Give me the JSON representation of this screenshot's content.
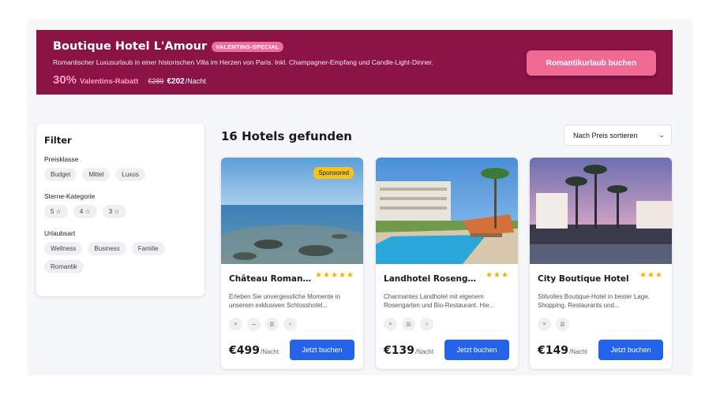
{
  "promo": {
    "title": "Boutique Hotel L'Amour",
    "badge": "VALENTINS-SPECIAL",
    "description": "Romantischer Luxusurlaub in einer historischen Villa im Herzen von Paris. Inkl. Champagner-Empfang und Candle-Light-Dinner.",
    "discount_pct": "30%",
    "discount_label": "Valentins-Rabatt",
    "old_price": "€289",
    "new_price": "€202",
    "unit": "/Nacht",
    "cta": "Romantikurlaub buchen"
  },
  "filter": {
    "title": "Filter",
    "groups": [
      {
        "title": "Preisklasse",
        "chips": [
          "Budget",
          "Mittel",
          "Luxus"
        ]
      },
      {
        "title": "Sterne-Kategorie",
        "chips": [
          "5 ☆",
          "4 ☆",
          "3 ☆"
        ]
      },
      {
        "title": "Urlaubsart",
        "chips": [
          "Wellness",
          "Business",
          "Familie",
          "Romantik"
        ]
      }
    ]
  },
  "results": {
    "title": "16 Hotels gefunden",
    "sort_label": "Nach Preis sortieren"
  },
  "hotels": [
    {
      "name": "Château Roman...",
      "stars": "★★★★★",
      "sponsored": "Sponsored",
      "description": "Erleben Sie unvergessliche Momente in unserem exklusiven Schlosshotel...",
      "amenities": [
        "wifi-icon",
        "pool-icon",
        "restaurant-icon",
        "spa-icon"
      ],
      "price": "€499",
      "unit": "/Nacht",
      "cta": "Jetzt buchen"
    },
    {
      "name": "Landhotel Rosengar...",
      "stars": "★★★",
      "description": "Charmantes Landhotel mit eigenem Rosengarten und Bio-Restaurant. Hie...",
      "amenities": [
        "wifi-icon",
        "restaurant-icon",
        "spa-icon"
      ],
      "price": "€139",
      "unit": "/Nacht",
      "cta": "Jetzt buchen"
    },
    {
      "name": "City Boutique Hotel",
      "stars": "★★★",
      "description": "Stilvolles Boutique-Hotel in bester Lage. Shopping, Restaurants und...",
      "amenities": [
        "wifi-icon",
        "restaurant-icon"
      ],
      "price": "€149",
      "unit": "/Nacht",
      "cta": "Jetzt buchen"
    }
  ]
}
